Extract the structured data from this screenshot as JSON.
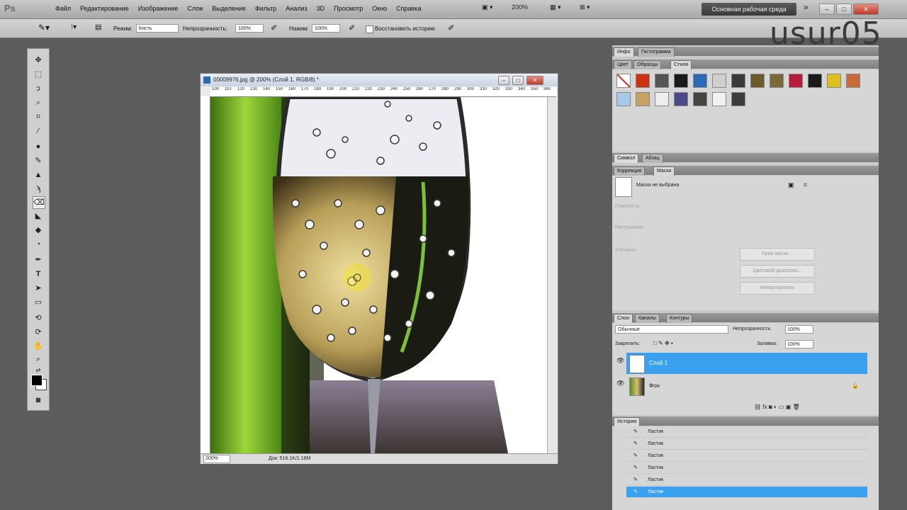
{
  "app": {
    "logo": "Ps"
  },
  "menu": [
    "Файл",
    "Редактирование",
    "Изображение",
    "Слои",
    "Выделение",
    "Фильтр",
    "Анализ",
    "3D",
    "Просмотр",
    "Окно",
    "Справка"
  ],
  "menubar": {
    "zoom": "200%",
    "workspace": "Основная рабочая среда",
    "expand": "»",
    "min": "–",
    "max": "□",
    "close": "✕"
  },
  "options": {
    "mode_label": "Режим:",
    "mode_value": "Кисть",
    "opacity_label": "Непрозрачность:",
    "opacity_value": "100%",
    "pressure_label": "Нажим:",
    "pressure_value": "100%",
    "restore_label": "Восстановить историю"
  },
  "watermark": "usur05",
  "document": {
    "title": "00009976.jpg @ 200% (Слой 1, RGB/8) *",
    "ruler_ticks": [
      "100",
      "110",
      "120",
      "130",
      "140",
      "150",
      "160",
      "170",
      "180",
      "190",
      "200",
      "210",
      "220",
      "230",
      "240",
      "250",
      "260",
      "270",
      "280",
      "290",
      "300",
      "310",
      "320",
      "330",
      "340",
      "350",
      "360"
    ],
    "zoom": "200%",
    "status": "Док: 516.1K/1.18M"
  },
  "panel_info": {
    "tabs": [
      "Инфо",
      "Гистограмма"
    ]
  },
  "panel_styles": {
    "tabs": [
      "Цвет",
      "Образцы",
      "Стили"
    ],
    "active": 2,
    "swatches": [
      "#ffffff",
      "#cc3311",
      "#555555",
      "#1a1a1a",
      "#2a6ab8",
      "#cfcfcf",
      "#3a3a3a",
      "#6b5a2a",
      "#7a6a3a",
      "#b81c3a",
      "#1a1a1a",
      "#e0c020",
      "#c86a3a",
      "#a8c8e8",
      "#c8a060",
      "#eeeeee",
      "#4a4a8a",
      "#444444",
      "#f2f2f2",
      "#3c3c3c"
    ]
  },
  "panel_nav": {
    "tabs": [
      "Символ",
      "Абзац"
    ]
  },
  "panel_masks": {
    "tabs": [
      "Коррекция",
      "Маски"
    ],
    "active": 1,
    "none_text": "Маска не выбрана",
    "density": "Плотность:",
    "feather": "Растушевка:",
    "refine": "Уточнить:",
    "edge_btn": "Край маски...",
    "color_btn": "Цветовой диапазон...",
    "invert_btn": "Инвертировать"
  },
  "panel_layers": {
    "tabs": [
      "Слои",
      "Каналы",
      "Контуры"
    ],
    "active": 0,
    "blend": "Обычные",
    "opacity_label": "Непрозрачность:",
    "opacity_value": "100%",
    "lock_label": "Закрепить:",
    "fill_label": "Заливка:",
    "fill_value": "100%",
    "layers": [
      {
        "name": "Слой 1"
      },
      {
        "name": "Фон"
      }
    ]
  },
  "panel_history": {
    "tabs": [
      "История"
    ],
    "items": [
      "Ластик",
      "Ластик",
      "Ластик",
      "Ластик",
      "Ластик",
      "Ластик"
    ]
  }
}
